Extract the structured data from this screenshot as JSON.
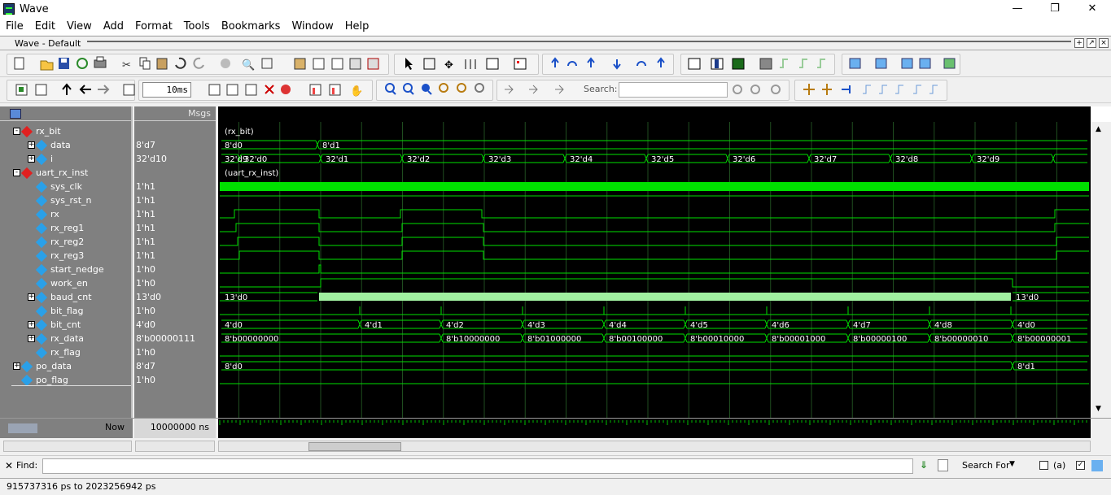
{
  "window": {
    "title": "Wave",
    "min": "—",
    "max": "❐",
    "close": "✕"
  },
  "menu": [
    "File",
    "Edit",
    "View",
    "Add",
    "Format",
    "Tools",
    "Bookmarks",
    "Window",
    "Help"
  ],
  "wave_window": {
    "title": "Wave - Default"
  },
  "toolbar": {
    "zoom_value": "10ms",
    "search_label": "Search:",
    "search_value": ""
  },
  "columns": {
    "msgs": "Msgs"
  },
  "signals": [
    {
      "name": "rx_bit",
      "value": "",
      "indent": 0,
      "kind": "group",
      "expand": "-"
    },
    {
      "name": "data",
      "value": "8'd7",
      "indent": 1,
      "kind": "bus",
      "expand": "+"
    },
    {
      "name": "i",
      "value": "32'd10",
      "indent": 1,
      "kind": "bus",
      "expand": "+"
    },
    {
      "name": "uart_rx_inst",
      "value": "",
      "indent": 0,
      "kind": "group",
      "expand": "-"
    },
    {
      "name": "sys_clk",
      "value": "1'h1",
      "indent": 1,
      "kind": "wire",
      "expand": ""
    },
    {
      "name": "sys_rst_n",
      "value": "1'h1",
      "indent": 1,
      "kind": "wire",
      "expand": ""
    },
    {
      "name": "rx",
      "value": "1'h1",
      "indent": 1,
      "kind": "wire",
      "expand": ""
    },
    {
      "name": "rx_reg1",
      "value": "1'h1",
      "indent": 1,
      "kind": "wire",
      "expand": ""
    },
    {
      "name": "rx_reg2",
      "value": "1'h1",
      "indent": 1,
      "kind": "wire",
      "expand": ""
    },
    {
      "name": "rx_reg3",
      "value": "1'h1",
      "indent": 1,
      "kind": "wire",
      "expand": ""
    },
    {
      "name": "start_nedge",
      "value": "1'h0",
      "indent": 1,
      "kind": "wire",
      "expand": ""
    },
    {
      "name": "work_en",
      "value": "1'h0",
      "indent": 1,
      "kind": "wire",
      "expand": ""
    },
    {
      "name": "baud_cnt",
      "value": "13'd0",
      "indent": 1,
      "kind": "bus",
      "expand": "+"
    },
    {
      "name": "bit_flag",
      "value": "1'h0",
      "indent": 1,
      "kind": "wire",
      "expand": ""
    },
    {
      "name": "bit_cnt",
      "value": "4'd0",
      "indent": 1,
      "kind": "bus",
      "expand": "+"
    },
    {
      "name": "rx_data",
      "value": "8'b00000111",
      "indent": 1,
      "kind": "bus",
      "expand": "+"
    },
    {
      "name": "rx_flag",
      "value": "1'h0",
      "indent": 1,
      "kind": "wire",
      "expand": ""
    },
    {
      "name": "po_data",
      "value": "8'd7",
      "indent": 0,
      "kind": "bus",
      "expand": "+"
    },
    {
      "name": "po_flag",
      "value": "1'h0",
      "indent": 0,
      "kind": "wire",
      "expand": ""
    }
  ],
  "wave_labels": {
    "rx_bit": "(rx_bit)",
    "uart_rx_inst": "(uart_rx_inst)",
    "data": [
      "8'd0",
      "8'd1"
    ],
    "i": [
      "32'd9",
      "32'd0",
      "32'd1",
      "32'd2",
      "32'd3",
      "32'd4",
      "32'd5",
      "32'd6",
      "32'd7",
      "32'd8",
      "32'd9"
    ],
    "baud_cnt": [
      "13'd0",
      "13'd0"
    ],
    "bit_cnt": [
      "4'd0",
      "4'd1",
      "4'd2",
      "4'd3",
      "4'd4",
      "4'd5",
      "4'd6",
      "4'd7",
      "4'd8",
      "4'd0"
    ],
    "rx_data": [
      "8'b00000000",
      "8'b10000000",
      "8'b01000000",
      "8'b00100000",
      "8'b00010000",
      "8'b00001000",
      "8'b00000100",
      "8'b00000010",
      "8'b00000001"
    ],
    "po_data": [
      "8'd0",
      "8'd1"
    ]
  },
  "now": {
    "label": "Now",
    "value": "10000000 ns"
  },
  "find": {
    "label": "Find:",
    "search_for": "Search For",
    "aa": "(a)"
  },
  "status": "915737316 ps to 2023256942 ps"
}
